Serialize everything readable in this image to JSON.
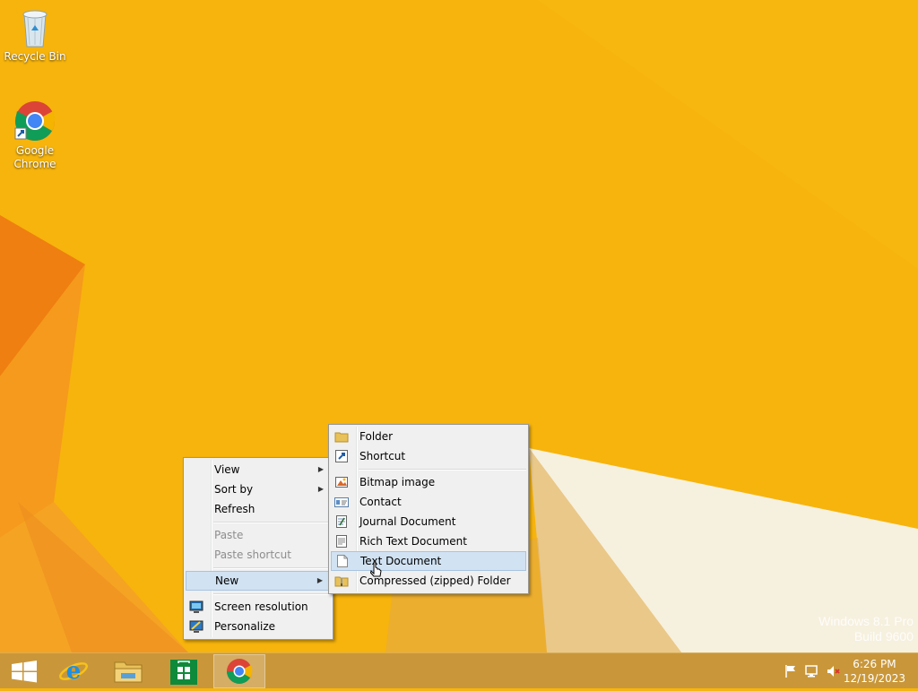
{
  "desktop": {
    "icons": [
      {
        "label": "Recycle Bin",
        "icon": "recycle-bin-icon"
      },
      {
        "label": "Google\nChrome",
        "icon": "chrome-icon"
      }
    ],
    "watermark": {
      "line1": "Windows 8.1 Pro",
      "line2": "Build 9600"
    }
  },
  "context_menu": {
    "items": [
      {
        "label": "View",
        "submenu": true
      },
      {
        "label": "Sort by",
        "submenu": true
      },
      {
        "label": "Refresh"
      },
      {
        "label": "Paste",
        "disabled": true
      },
      {
        "label": "Paste shortcut",
        "disabled": true
      },
      {
        "label": "New",
        "submenu": true,
        "highlighted": true
      },
      {
        "label": "Screen resolution",
        "icon": "screen-resolution-icon"
      },
      {
        "label": "Personalize",
        "icon": "personalize-icon"
      }
    ]
  },
  "new_submenu": {
    "items": [
      {
        "label": "Folder",
        "icon": "folder-icon"
      },
      {
        "label": "Shortcut",
        "icon": "shortcut-icon"
      },
      {
        "label": "Bitmap image",
        "icon": "bitmap-icon"
      },
      {
        "label": "Contact",
        "icon": "contact-icon"
      },
      {
        "label": "Journal Document",
        "icon": "journal-icon"
      },
      {
        "label": "Rich Text Document",
        "icon": "rich-text-icon"
      },
      {
        "label": "Text Document",
        "icon": "text-document-icon",
        "highlighted": true
      },
      {
        "label": "Compressed (zipped) Folder",
        "icon": "zip-folder-icon"
      }
    ]
  },
  "taskbar": {
    "buttons": [
      "start-button",
      "internet-explorer",
      "file-explorer",
      "store",
      "google-chrome"
    ],
    "active": "google-chrome",
    "tray_icons": [
      "action-center-flag-icon",
      "network-icon",
      "volume-muted-icon"
    ],
    "clock": {
      "time": "6:26 PM",
      "date": "12/19/2023"
    }
  },
  "colors": {
    "wallpaper": "#f7b40c",
    "accent_orange": "#ef7f10",
    "taskbar": "#c9973a",
    "menu_bg": "#f0f0f0",
    "menu_highlight": "#d1e2f2"
  }
}
